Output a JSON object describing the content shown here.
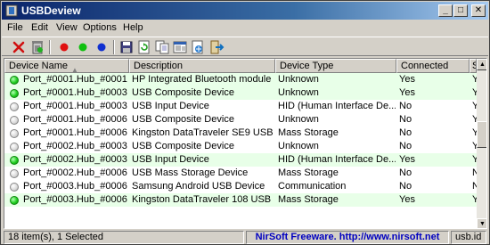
{
  "window": {
    "title": "USBDeview"
  },
  "menu": [
    "File",
    "Edit",
    "View",
    "Options",
    "Help"
  ],
  "toolbar": [
    {
      "name": "disconnect-icon"
    },
    {
      "name": "uninstall-icon"
    },
    {
      "name": "sep"
    },
    {
      "name": "red-dot-icon",
      "color": "#e01010"
    },
    {
      "name": "green-dot-icon",
      "color": "#10c010"
    },
    {
      "name": "blue-dot-icon",
      "color": "#1030d0"
    },
    {
      "name": "sep"
    },
    {
      "name": "save-icon"
    },
    {
      "name": "refresh-icon"
    },
    {
      "name": "copy-icon"
    },
    {
      "name": "properties-icon"
    },
    {
      "name": "html-report-icon"
    },
    {
      "name": "exit-icon"
    }
  ],
  "columns": [
    "Device Name",
    "Description",
    "Device Type",
    "Connected",
    "S"
  ],
  "rows": [
    {
      "connected_state": "on",
      "device_name": "Port_#0001.Hub_#0001",
      "description": "HP Integrated Bluetooth module",
      "device_type": "Unknown",
      "connected": "Yes",
      "s": "Y"
    },
    {
      "connected_state": "on",
      "device_name": "Port_#0001.Hub_#0003",
      "description": "USB Composite Device",
      "device_type": "Unknown",
      "connected": "Yes",
      "s": "Y"
    },
    {
      "connected_state": "off",
      "device_name": "Port_#0001.Hub_#0003",
      "description": "USB Input Device",
      "device_type": "HID (Human Interface De...",
      "connected": "No",
      "s": "Y"
    },
    {
      "connected_state": "off",
      "device_name": "Port_#0001.Hub_#0006",
      "description": "USB Composite Device",
      "device_type": "Unknown",
      "connected": "No",
      "s": "Y"
    },
    {
      "connected_state": "off",
      "device_name": "Port_#0001.Hub_#0006",
      "description": "Kingston DataTraveler SE9 USB ...",
      "device_type": "Mass Storage",
      "connected": "No",
      "s": "Y"
    },
    {
      "connected_state": "off",
      "device_name": "Port_#0002.Hub_#0003",
      "description": "USB Composite Device",
      "device_type": "Unknown",
      "connected": "No",
      "s": "Y"
    },
    {
      "connected_state": "on",
      "device_name": "Port_#0002.Hub_#0003",
      "description": "USB Input Device",
      "device_type": "HID (Human Interface De...",
      "connected": "Yes",
      "s": "Y"
    },
    {
      "connected_state": "off",
      "device_name": "Port_#0002.Hub_#0006",
      "description": "USB Mass Storage Device",
      "device_type": "Mass Storage",
      "connected": "No",
      "s": "N"
    },
    {
      "connected_state": "off",
      "device_name": "Port_#0003.Hub_#0006",
      "description": "Samsung Android USB Device",
      "device_type": "Communication",
      "connected": "No",
      "s": "N"
    },
    {
      "connected_state": "on",
      "device_name": "Port_#0003.Hub_#0006",
      "description": "Kingston DataTraveler 108 USB ...",
      "device_type": "Mass Storage",
      "connected": "Yes",
      "s": "Y"
    }
  ],
  "status": {
    "count": "18 item(s), 1 Selected",
    "link": "NirSoft Freeware.  http://www.nirsoft.net",
    "extra": "usb.id"
  }
}
